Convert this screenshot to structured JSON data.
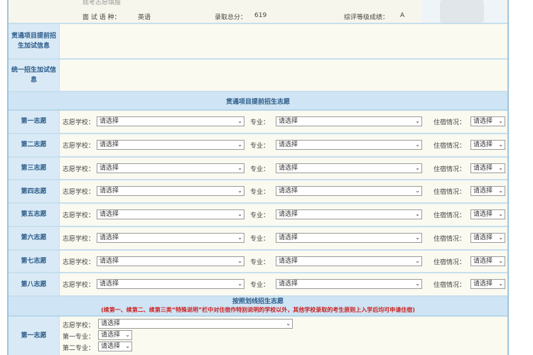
{
  "header": {
    "faded_text": "成考志愿填报",
    "exam_lang_label": "面  试  语  种：",
    "exam_lang_value": "英语",
    "total_label": "录取总分：",
    "total_value": "619",
    "grade_label": "综评等级成绩：",
    "grade_value": "A"
  },
  "info_rows": [
    {
      "label": "贯通项目提前招生加试信息"
    },
    {
      "label": "统一招生加试信息"
    }
  ],
  "section1_title": "贯通项目提前招生志愿",
  "choices": [
    {
      "label": "第一志愿"
    },
    {
      "label": "第二志愿"
    },
    {
      "label": "第三志愿"
    },
    {
      "label": "第四志愿"
    },
    {
      "label": "第五志愿"
    },
    {
      "label": "第六志愿"
    },
    {
      "label": "第七志愿"
    },
    {
      "label": "第八志愿"
    }
  ],
  "field_labels": {
    "school": "志愿学校：",
    "major": "专业：",
    "housing": "住宿情况："
  },
  "select_placeholder": "请选择",
  "section2": {
    "title": "按照划线招生志愿",
    "note": "(续第一、续第二、续第三类“特殊说明”栏中对住宿作特别说明的学校以外，其他学校录取的考生原则上入学后均可申请住宿)",
    "row_label": "第一志愿",
    "lines": [
      "志愿学校：",
      "第一专业：",
      "第二专业："
    ]
  }
}
